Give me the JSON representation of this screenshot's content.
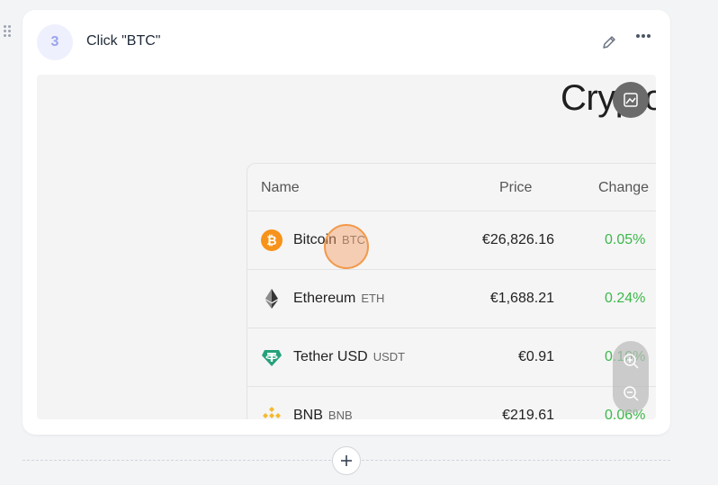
{
  "step": {
    "number": "3",
    "title": "Click \"BTC\""
  },
  "screenshot": {
    "heading": "Cryptoc",
    "table": {
      "headers": {
        "name": "Name",
        "price": "Price",
        "change": "Change"
      },
      "rows": [
        {
          "name": "Bitcoin",
          "symbol": "BTC",
          "price": "€26,826.16",
          "change": "0.05%",
          "icon": "bitcoin-icon"
        },
        {
          "name": "Ethereum",
          "symbol": "ETH",
          "price": "€1,688.21",
          "change": "0.24%",
          "icon": "ethereum-icon"
        },
        {
          "name": "Tether USD",
          "symbol": "USDT",
          "price": "€0.91",
          "change": "0.10%",
          "icon": "tether-icon"
        },
        {
          "name": "BNB",
          "symbol": "BNB",
          "price": "€219.61",
          "change": "0.06%",
          "icon": "bnb-icon"
        }
      ]
    }
  },
  "colors": {
    "accent": "#9aa4ee",
    "positive_change": "#3cb84b",
    "click_marker": "#f2994a"
  },
  "icons": {
    "drag": "drag-handle-icon",
    "edit": "pencil-icon",
    "more": "more-dots-icon",
    "image": "image-edit-icon",
    "zoom_in": "zoom-in-icon",
    "zoom_out": "zoom-out-icon",
    "add": "plus-icon"
  }
}
